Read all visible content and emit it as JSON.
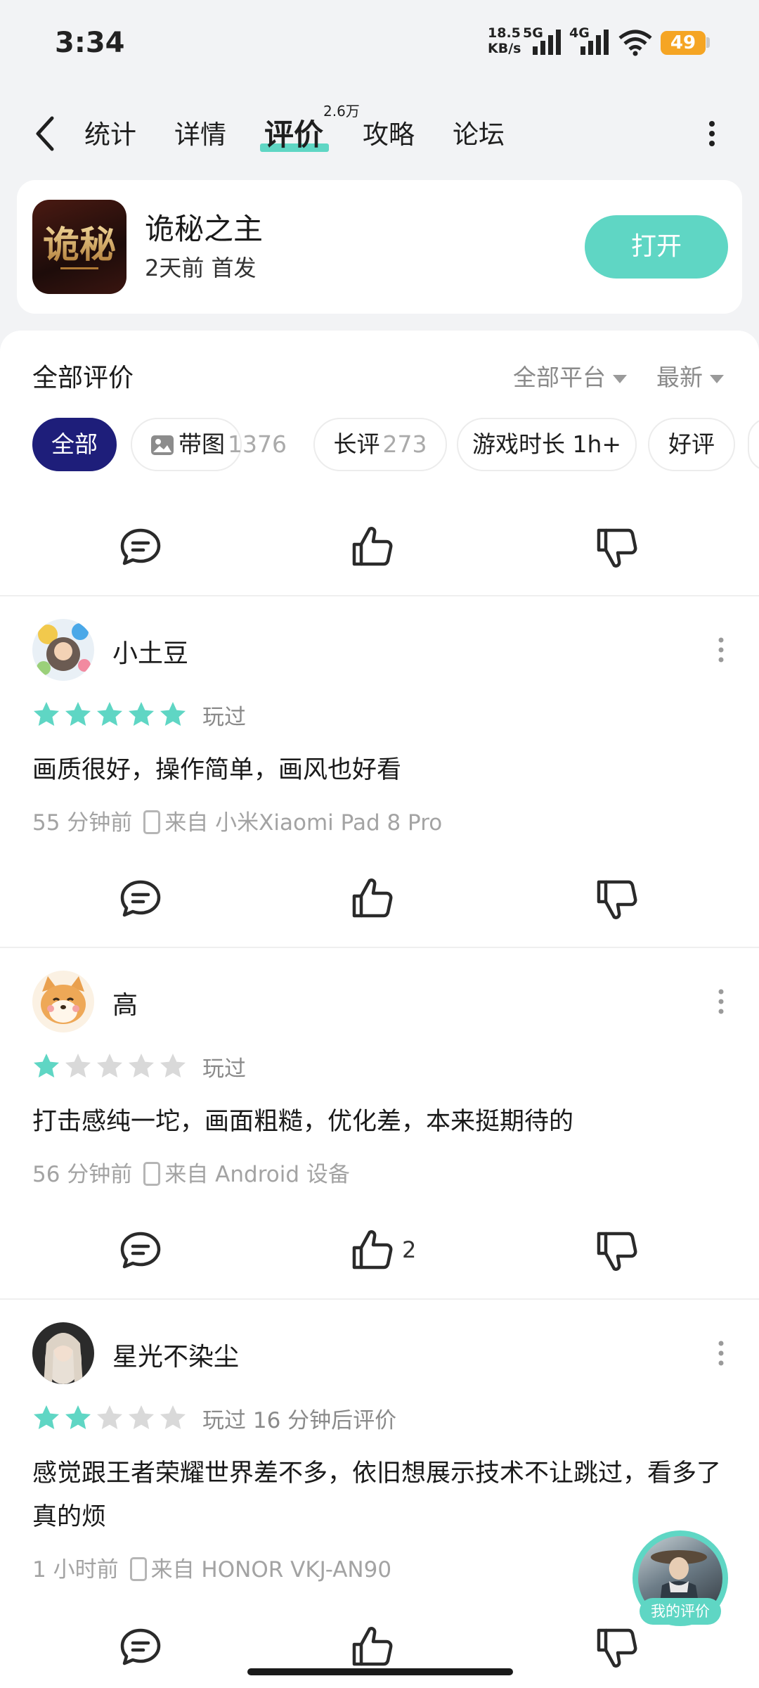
{
  "status_bar": {
    "time": "3:34",
    "speed_value": "18.5",
    "speed_unit": "KB/s",
    "net1": "5G",
    "net2": "4G",
    "battery": "49"
  },
  "nav": {
    "tabs": [
      {
        "label": "统计"
      },
      {
        "label": "详情"
      },
      {
        "label": "评价",
        "badge": "2.6万",
        "active": true
      },
      {
        "label": "攻略"
      },
      {
        "label": "论坛"
      }
    ]
  },
  "game": {
    "name": "诡秘之主",
    "meta": "2天前 首发",
    "open_label": "打开",
    "icon_text": "诡秘"
  },
  "reviews_header": {
    "title": "全部评价",
    "platform_filter": "全部平台",
    "sort": "最新"
  },
  "filter_chips": [
    {
      "label": "全部",
      "count": ""
    },
    {
      "label": "带图",
      "count": "1376"
    },
    {
      "label": "长评",
      "count": "273"
    },
    {
      "label": "游戏时长 1h+",
      "count": ""
    },
    {
      "label": "好评",
      "count": ""
    }
  ],
  "reviews": [
    {
      "name": "小土豆",
      "rating": 5,
      "played": "玩过",
      "text": "画质很好，操作简单，画风也好看",
      "time": "55 分钟前",
      "device": "来自 小米Xiaomi Pad 8 Pro",
      "likes": ""
    },
    {
      "name": "高",
      "rating": 1,
      "played": "玩过",
      "text": "打击感纯一坨，画面粗糙，优化差，本来挺期待的",
      "time": "56 分钟前",
      "device": "来自 Android 设备",
      "likes": "2"
    },
    {
      "name": "星光不染尘",
      "rating": 2,
      "played": "玩过 16 分钟后评价",
      "text": "感觉跟王者荣耀世界差不多，依旧想展示技术不让跳过，看多了真的烦",
      "time": "1 小时前",
      "device": "来自 HONOR VKJ-AN90",
      "likes": ""
    }
  ],
  "my_review_label": "我的评价",
  "colors": {
    "accent": "#5fd6c4",
    "chip_active": "#1e1e7a",
    "star_on": "#5fd6c4",
    "star_off": "#d9d9d9"
  },
  "icons": [
    "back-icon",
    "more-icon",
    "comment-icon",
    "thumbs-up-icon",
    "thumbs-down-icon",
    "star-icon",
    "image-icon",
    "device-icon"
  ]
}
